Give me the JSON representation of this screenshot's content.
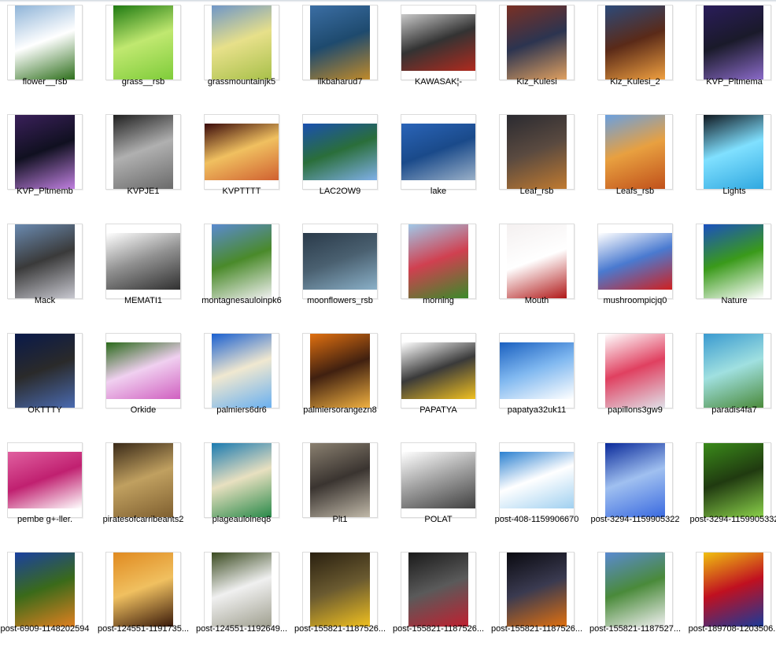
{
  "window": {
    "title": ""
  },
  "thumbnails": [
    {
      "name": "flower__rsb",
      "colors": [
        "#8fb4d8",
        "#2e6f1c",
        "#ffffff"
      ]
    },
    {
      "name": "grass__rsb",
      "colors": [
        "#1f7a12",
        "#7fcc3a",
        "#c0e870"
      ]
    },
    {
      "name": "grassmountainjk5",
      "colors": [
        "#6f96c8",
        "#a8c04a",
        "#e7e08a"
      ]
    },
    {
      "name": "ilkbaharud7",
      "colors": [
        "#3b6ea4",
        "#c08a2a",
        "#1e4a6e"
      ]
    },
    {
      "name": "KAWASAK¦-",
      "colors": [
        "#c8c8c8",
        "#b02a1e",
        "#333333"
      ]
    },
    {
      "name": "Kiz_Kulesi",
      "colors": [
        "#7a3024",
        "#e0a060",
        "#2c3450"
      ]
    },
    {
      "name": "Kiz_Kulesi_2",
      "colors": [
        "#2c4a7a",
        "#f0a040",
        "#5a2a18"
      ]
    },
    {
      "name": "KVP_Pltmema",
      "colors": [
        "#2a1c5a",
        "#8a6ac8",
        "#1a1a2a"
      ]
    },
    {
      "name": "KVP_Pltmemb",
      "colors": [
        "#3a205a",
        "#c080e0",
        "#101020"
      ]
    },
    {
      "name": "KVPJE1",
      "colors": [
        "#202020",
        "#6a6a6a",
        "#b0b0b0"
      ]
    },
    {
      "name": "KVPTTTT",
      "colors": [
        "#3a0a0a",
        "#d06030",
        "#f0c060"
      ]
    },
    {
      "name": "LAC2OW9",
      "colors": [
        "#1a50b0",
        "#80b0e8",
        "#2a6e3a"
      ]
    },
    {
      "name": "lake",
      "colors": [
        "#2a64b8",
        "#9ab0c8",
        "#1a4a8a"
      ]
    },
    {
      "name": "Leaf_rsb",
      "colors": [
        "#2a2a30",
        "#c07a30",
        "#5a4a40"
      ]
    },
    {
      "name": "Leafs_rsb",
      "colors": [
        "#6aa0e0",
        "#c0501a",
        "#e8a040"
      ]
    },
    {
      "name": "Lights",
      "colors": [
        "#101820",
        "#30a8e0",
        "#80e0ff"
      ]
    },
    {
      "name": "Mack",
      "colors": [
        "#6a8ab0",
        "#c8c8d0",
        "#3a3a3a"
      ]
    },
    {
      "name": "MEMATI1",
      "colors": [
        "#ffffff",
        "#303030",
        "#909090"
      ]
    },
    {
      "name": "montagnesauloinpk6",
      "colors": [
        "#5a8ad0",
        "#f0f0f0",
        "#4a8a2a"
      ]
    },
    {
      "name": "moonflowers_rsb",
      "colors": [
        "#2a3a4a",
        "#8ab0c8",
        "#4a6070"
      ]
    },
    {
      "name": "morning",
      "colors": [
        "#a0c8e8",
        "#3a8a2a",
        "#d04050"
      ]
    },
    {
      "name": "Mouth",
      "colors": [
        "#f4f0f0",
        "#b01818",
        "#ffffff"
      ]
    },
    {
      "name": "mushroompicjq0",
      "colors": [
        "#ffffff",
        "#d02020",
        "#4a7ad0"
      ]
    },
    {
      "name": "Nature",
      "colors": [
        "#1a50c0",
        "#ffffff",
        "#3a9a1a"
      ]
    },
    {
      "name": "OKTTTY",
      "colors": [
        "#0a1a4a",
        "#4a6ab0",
        "#2a2a2a"
      ]
    },
    {
      "name": "Orkide",
      "colors": [
        "#2a6a1a",
        "#d060c0",
        "#f0d0f0"
      ]
    },
    {
      "name": "palmiers6dr6",
      "colors": [
        "#1a60d0",
        "#6ab0f0",
        "#f0e8d0"
      ]
    },
    {
      "name": "palmiersorangezn8",
      "colors": [
        "#e07010",
        "#f0b040",
        "#402010"
      ]
    },
    {
      "name": "PAPATYA",
      "colors": [
        "#ffffff",
        "#f0c020",
        "#3a3a3a"
      ]
    },
    {
      "name": "papatya32uk11",
      "colors": [
        "#1a60c0",
        "#ffffff",
        "#80b8f0"
      ]
    },
    {
      "name": "papillons3gw9",
      "colors": [
        "#ffffff",
        "#e0e0e8",
        "#e04060"
      ]
    },
    {
      "name": "paradis4fa7",
      "colors": [
        "#3a9ad0",
        "#4a8a3a",
        "#a0e0e0"
      ]
    },
    {
      "name": "pembe g+-ller.",
      "colors": [
        "#e060a0",
        "#ffffff",
        "#c02070"
      ]
    },
    {
      "name": "piratesofcarribeants2",
      "colors": [
        "#3a2a18",
        "#806030",
        "#c0a060"
      ]
    },
    {
      "name": "plageauloineq8",
      "colors": [
        "#1a7ab0",
        "#2a8a4a",
        "#e8e0c0"
      ]
    },
    {
      "name": "Plt1",
      "colors": [
        "#8a8070",
        "#c0b8a8",
        "#3a3430"
      ]
    },
    {
      "name": "POLAT",
      "colors": [
        "#ffffff",
        "#404040",
        "#a0a0a0"
      ]
    },
    {
      "name": "post-408-1159906670",
      "colors": [
        "#2a80d0",
        "#a0d0f0",
        "#ffffff"
      ]
    },
    {
      "name": "post-3294-1159905322",
      "colors": [
        "#0a2a9a",
        "#3a6ae0",
        "#a0c0f0"
      ]
    },
    {
      "name": "post-3294-1159905332",
      "colors": [
        "#3a8a1a",
        "#8ad04a",
        "#203a10"
      ]
    },
    {
      "name": "post-6909-1148202594",
      "colors": [
        "#1a40a0",
        "#e08020",
        "#3a6a1a"
      ]
    },
    {
      "name": "post-124551-1191735...",
      "colors": [
        "#e08a20",
        "#3a1a0a",
        "#f0c060"
      ]
    },
    {
      "name": "post-124551-1192649...",
      "colors": [
        "#3a4a20",
        "#a0a090",
        "#f0f0f0"
      ]
    },
    {
      "name": "post-155821-1187526...",
      "colors": [
        "#2a2010",
        "#f0c020",
        "#6a5a30"
      ]
    },
    {
      "name": "post-155821-1187526...",
      "colors": [
        "#1a1a1a",
        "#c02030",
        "#5a5a5a"
      ]
    },
    {
      "name": "post-155821-1187526...",
      "colors": [
        "#0a0a10",
        "#e07010",
        "#3a3a50"
      ]
    },
    {
      "name": "post-155821-1187527...",
      "colors": [
        "#5a8ad0",
        "#f0f0f0",
        "#4a8a3a"
      ]
    },
    {
      "name": "post-189708-1203506...",
      "colors": [
        "#f0c010",
        "#1a3a9a",
        "#c01020"
      ]
    }
  ]
}
